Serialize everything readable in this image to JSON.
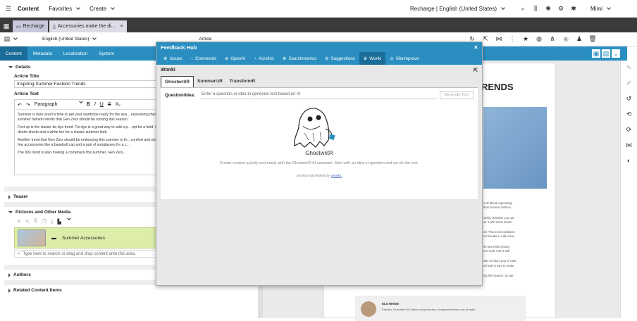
{
  "topbar": {
    "content": "Content",
    "favorites": "Favorites",
    "create": "Create",
    "site": "Recharge | English (United States)",
    "user": "Mimi"
  },
  "tabs": [
    {
      "label": "Recharge"
    },
    {
      "label": "Accessories make the di..."
    }
  ],
  "toolbar2": {
    "locale": "English (United States)",
    "article": "Article"
  },
  "content_tabs": [
    "Content",
    "Metadata",
    "Localization",
    "System"
  ],
  "details": {
    "section": "Details",
    "article_title_label": "Article Title",
    "article_title_value": "Inspiring Summer Fashion Trends",
    "article_text_label": "Article Text",
    "paragraph_select": "Paragraph",
    "para1": "Summer is here and it's time to get your wardrobe ready for the sea... expressing their individual style and embracing the latest fashion tr... summer fashion trends that Gen Zers should be rocking this season.",
    "para2": "First up is the classic tie-dye trend. Tie-dye is a great way to add a p... opt for a bold, bright pattern or a subtle, pastel look, tie-dye is sure t... denim shorts and a white tee for a classic summer look.",
    "para3": "Another trend that Gen Zers should be embracing this summer is th... comfort and style, making it perfect for summer days. Think joggers... few accessories like a baseball cap and a pair of sunglasses for a c...",
    "para4": "The 90s trend is also making a comeback this summer. Gen Zers..."
  },
  "teaser": "Teaser",
  "pictures": {
    "section": "Pictures and Other Media",
    "item": "Summer Accessories",
    "placeholder": "Type here to search or drag and drop content onto this area."
  },
  "authors": "Authors",
  "related": "Related Content Items",
  "modal": {
    "title": "Feedback Hub",
    "tabs": [
      "Issues",
      "Comments",
      "OpenAI",
      "Acrolinx",
      "Searchmetrics",
      "Suggestions",
      "Wonki",
      "Siteimprove"
    ],
    "wonki": "Wonki",
    "subtabs": [
      "GhostwritR",
      "SummarizR",
      "TransformR"
    ],
    "question_label": "Question/Idea:",
    "question_placeholder": "Enter a question or idea to generate text based on AI",
    "generate": "Generate Text",
    "ghost_name": "GhostwritR",
    "ghost_desc": "Create content quickly and easily with the GhostwritR AI assistant. Start with an idea or question and we do the rest.",
    "service_prefix": "service provided by",
    "service_link": "wonki."
  },
  "preview": {
    "heading": "RENDS",
    "author_name": "ELS WANN",
    "author_desc": "Fashion Journalist for Calista using the day, Instagram fashion spy at night.",
    "side_lines": [
      "s all about expressing",
      "ttest summer fashion.",
      "uickly. Whether you opt",
      "air it with some denim",
      "ed. This trend combines",
      "ed sneakers. Add a few",
      "ith items like chunky",
      "mer look. Pair it with",
      "way to add a pop of color",
      "ed look is sure to make",
      "ing this season. So get"
    ]
  },
  "colors": {
    "blue": "#2a8fc0",
    "dark": "#3a3a3a"
  }
}
